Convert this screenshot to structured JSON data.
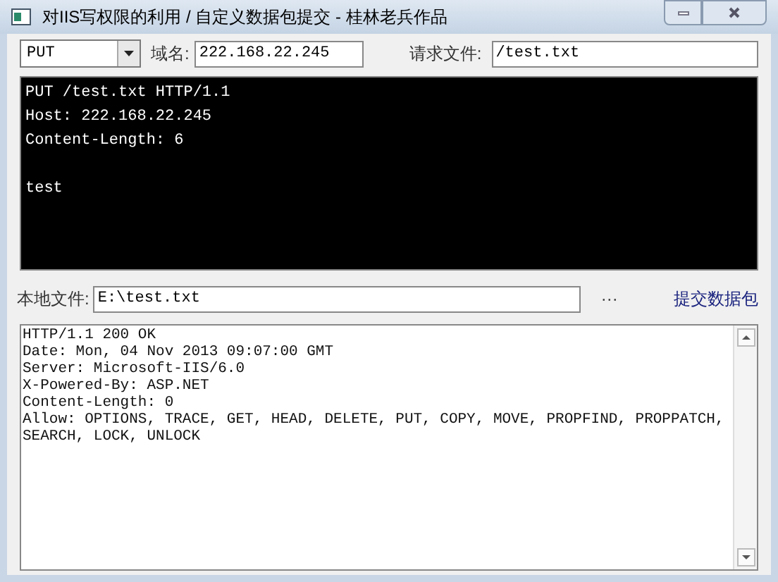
{
  "window": {
    "title": "对IIS写权限的利用 /  自定义数据包提交 - 桂林老兵作品"
  },
  "request": {
    "method": "PUT",
    "host_label": "域名:",
    "host": "222.168.22.245",
    "file_label": "请求文件:",
    "file": "/test.txt",
    "body": "PUT /test.txt HTTP/1.1\nHost: 222.168.22.245\nContent-Length: 6\n\ntest"
  },
  "local": {
    "label": "本地文件:",
    "path": "E:\\test.txt",
    "browse": "···",
    "submit": "提交数据包"
  },
  "response": {
    "text": "HTTP/1.1 200 OK\nDate: Mon, 04 Nov 2013 09:07:00 GMT\nServer: Microsoft-IIS/6.0\nX-Powered-By: ASP.NET\nContent-Length: 0\nAllow: OPTIONS, TRACE, GET, HEAD, DELETE, PUT, COPY, MOVE, PROPFIND, PROPPATCH,\nSEARCH, LOCK, UNLOCK"
  }
}
